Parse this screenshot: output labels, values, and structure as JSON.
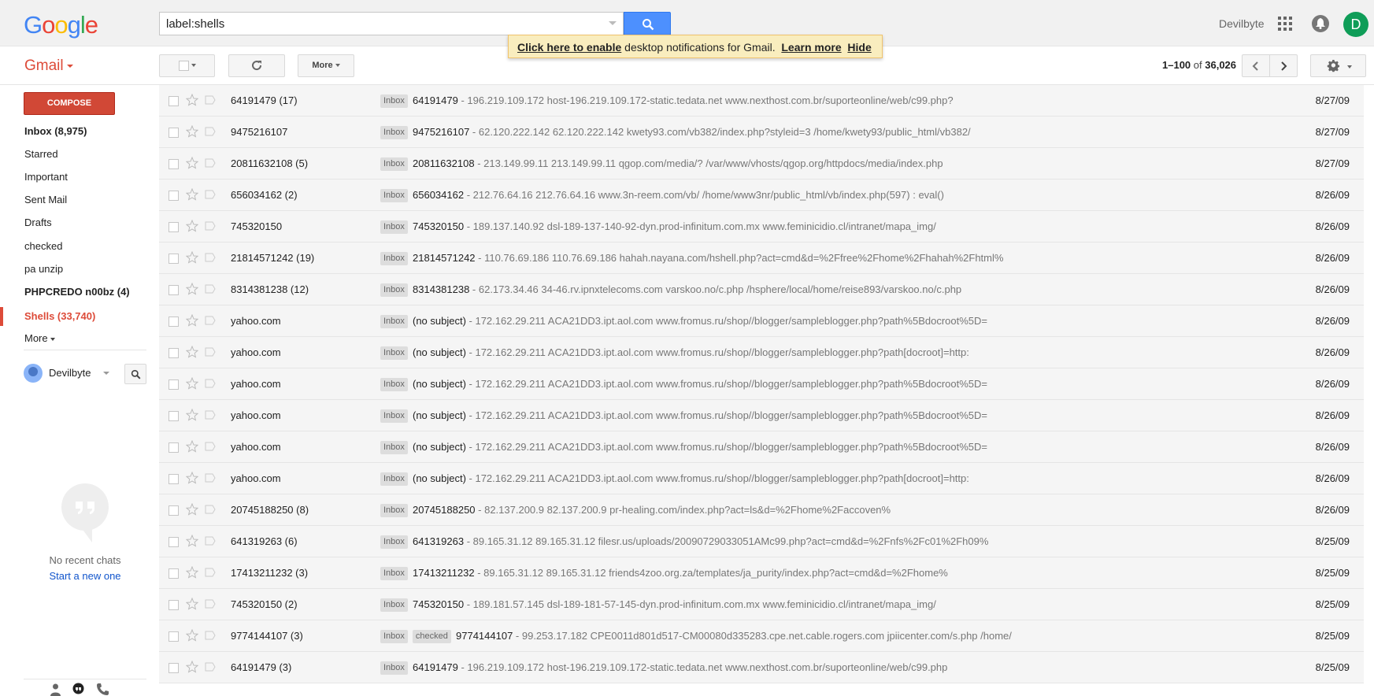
{
  "header": {
    "logo_text": "Google",
    "search_value": "label:shells",
    "user_name": "Devilbyte",
    "avatar_letter": "D",
    "colors": {
      "logo_blue": "#4285f4",
      "logo_red": "#ea4335",
      "logo_yellow": "#fbbc05",
      "logo_green": "#34a853",
      "avatar": "#0f9d58",
      "search_button": "#4d90fe"
    }
  },
  "notification": {
    "enable_link": "Click here to enable",
    "text": "desktop notifications for Gmail.",
    "learn_more": "Learn more",
    "hide": "Hide"
  },
  "toolbar": {
    "app_label": "Gmail",
    "more_label": "More",
    "range": "1–100",
    "of_text": "of",
    "total": "36,026"
  },
  "sidebar": {
    "compose_label": "COMPOSE",
    "items": [
      {
        "label": "Inbox (8,975)",
        "bold": true
      },
      {
        "label": "Starred"
      },
      {
        "label": "Important"
      },
      {
        "label": "Sent Mail"
      },
      {
        "label": "Drafts"
      },
      {
        "label": "checked"
      },
      {
        "label": "pa unzip"
      },
      {
        "label": "PHPCREDO n00bz (4)",
        "bold": true
      },
      {
        "label": "Shells (33,740)",
        "active": true
      },
      {
        "label": "More"
      }
    ],
    "hangouts_user": "Devilbyte",
    "no_chats": "No recent chats",
    "start_new": "Start a new one",
    "accent_color": "#dd4b39"
  },
  "messages": [
    {
      "sender": "64191479 (17)",
      "labels": [
        "Inbox"
      ],
      "subject": "64191479",
      "snippet": " - 196.219.109.172 host-196.219.109.172-static.tedata.net www.nexthost.com.br/suporteonline/web/c99.php?",
      "date": "8/27/09"
    },
    {
      "sender": "9475216107",
      "labels": [
        "Inbox"
      ],
      "subject": "9475216107",
      "snippet": " - 62.120.222.142 62.120.222.142 kwety93.com/vb382/index.php?styleid=3 /home/kwety93/public_html/vb382/",
      "date": "8/27/09"
    },
    {
      "sender": "20811632108 (5)",
      "labels": [
        "Inbox"
      ],
      "subject": "20811632108",
      "snippet": " - 213.149.99.11 213.149.99.11 qgop.com/media/? /var/www/vhosts/qgop.org/httpdocs/media/index.php",
      "date": "8/27/09"
    },
    {
      "sender": "656034162 (2)",
      "labels": [
        "Inbox"
      ],
      "subject": "656034162",
      "snippet": " - 212.76.64.16 212.76.64.16 www.3n-reem.com/vb/ /home/www3nr/public_html/vb/index.php(597) : eval()",
      "date": "8/26/09"
    },
    {
      "sender": "745320150",
      "labels": [
        "Inbox"
      ],
      "subject": "745320150",
      "snippet": " - 189.137.140.92 dsl-189-137-140-92-dyn.prod-infinitum.com.mx www.feminicidio.cl/intranet/mapa_img/",
      "date": "8/26/09"
    },
    {
      "sender": "21814571242 (19)",
      "labels": [
        "Inbox"
      ],
      "subject": "21814571242",
      "snippet": " - 110.76.69.186 110.76.69.186 hahah.nayana.com/hshell.php?act=cmd&d=%2Ffree%2Fhome%2Fhahah%2Fhtml%",
      "date": "8/26/09"
    },
    {
      "sender": "8314381238 (12)",
      "labels": [
        "Inbox"
      ],
      "subject": "8314381238",
      "snippet": " - 62.173.34.46 34-46.rv.ipnxtelecoms.com varskoo.no/c.php /hsphere/local/home/reise893/varskoo.no/c.php",
      "date": "8/26/09"
    },
    {
      "sender": "yahoo.com",
      "labels": [
        "Inbox"
      ],
      "subject": "(no subject)",
      "snippet": " - 172.162.29.211 ACA21DD3.ipt.aol.com www.fromus.ru/shop//blogger/sampleblogger.php?path%5Bdocroot%5D=",
      "date": "8/26/09"
    },
    {
      "sender": "yahoo.com",
      "labels": [
        "Inbox"
      ],
      "subject": "(no subject)",
      "snippet": " - 172.162.29.211 ACA21DD3.ipt.aol.com www.fromus.ru/shop//blogger/sampleblogger.php?path[docroot]=http:",
      "date": "8/26/09"
    },
    {
      "sender": "yahoo.com",
      "labels": [
        "Inbox"
      ],
      "subject": "(no subject)",
      "snippet": " - 172.162.29.211 ACA21DD3.ipt.aol.com www.fromus.ru/shop//blogger/sampleblogger.php?path%5Bdocroot%5D=",
      "date": "8/26/09"
    },
    {
      "sender": "yahoo.com",
      "labels": [
        "Inbox"
      ],
      "subject": "(no subject)",
      "snippet": " - 172.162.29.211 ACA21DD3.ipt.aol.com www.fromus.ru/shop//blogger/sampleblogger.php?path%5Bdocroot%5D=",
      "date": "8/26/09"
    },
    {
      "sender": "yahoo.com",
      "labels": [
        "Inbox"
      ],
      "subject": "(no subject)",
      "snippet": " - 172.162.29.211 ACA21DD3.ipt.aol.com www.fromus.ru/shop//blogger/sampleblogger.php?path%5Bdocroot%5D=",
      "date": "8/26/09"
    },
    {
      "sender": "yahoo.com",
      "labels": [
        "Inbox"
      ],
      "subject": "(no subject)",
      "snippet": " - 172.162.29.211 ACA21DD3.ipt.aol.com www.fromus.ru/shop//blogger/sampleblogger.php?path[docroot]=http:",
      "date": "8/26/09"
    },
    {
      "sender": "20745188250 (8)",
      "labels": [
        "Inbox"
      ],
      "subject": "20745188250",
      "snippet": " - 82.137.200.9 82.137.200.9 pr-healing.com/index.php?act=ls&d=%2Fhome%2Faccoven%",
      "date": "8/26/09"
    },
    {
      "sender": "641319263 (6)",
      "labels": [
        "Inbox"
      ],
      "subject": "641319263",
      "snippet": " - 89.165.31.12 89.165.31.12 filesr.us/uploads/20090729033051AMc99.php?act=cmd&d=%2Fnfs%2Fc01%2Fh09%",
      "date": "8/25/09"
    },
    {
      "sender": "17413211232 (3)",
      "labels": [
        "Inbox"
      ],
      "subject": "17413211232",
      "snippet": " - 89.165.31.12 89.165.31.12 friends4zoo.org.za/templates/ja_purity/index.php?act=cmd&d=%2Fhome%",
      "date": "8/25/09"
    },
    {
      "sender": "745320150 (2)",
      "labels": [
        "Inbox"
      ],
      "subject": "745320150",
      "snippet": " - 189.181.57.145 dsl-189-181-57-145-dyn.prod-infinitum.com.mx www.feminicidio.cl/intranet/mapa_img/",
      "date": "8/25/09"
    },
    {
      "sender": "9774144107 (3)",
      "labels": [
        "Inbox",
        "checked"
      ],
      "subject": "9774144107",
      "snippet": " - 99.253.17.182 CPE0011d801d517-CM00080d335283.cpe.net.cable.rogers.com jpiicenter.com/s.php /home/",
      "date": "8/25/09"
    },
    {
      "sender": "64191479 (3)",
      "labels": [
        "Inbox"
      ],
      "subject": "64191479",
      "snippet": " - 196.219.109.172 host-196.219.109.172-static.tedata.net www.nexthost.com.br/suporteonline/web/c99.php",
      "date": "8/25/09"
    }
  ]
}
